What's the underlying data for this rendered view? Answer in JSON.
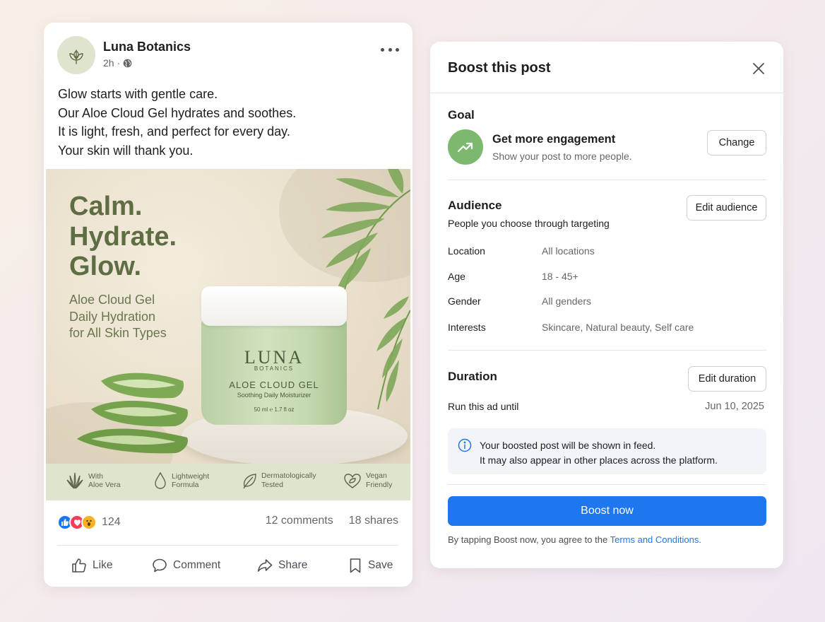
{
  "post": {
    "page_name": "Luna Botanics",
    "time": "2h",
    "separator": "·",
    "caption_lines": [
      "Glow starts with gentle care.",
      "Our Aloe Cloud Gel hydrates and soothes.",
      "It is light, fresh, and perfect for every day.",
      "Your skin will thank you."
    ],
    "image": {
      "headline": [
        "Calm.",
        "Hydrate.",
        "Glow."
      ],
      "subline": [
        "Aloe Cloud Gel",
        "Daily Hydration",
        "for All Skin Types"
      ],
      "jar": {
        "brand": "LUNA",
        "brand_sub": "BOTANICS",
        "product": "ALOE CLOUD GEL",
        "description": "Soothing Daily Moisturizer",
        "volume": "50 ml ℮ 1.7 fl oz"
      },
      "features": [
        {
          "icon": "aloe-icon",
          "lines": [
            "With",
            "Aloe Vera"
          ]
        },
        {
          "icon": "droplet-icon",
          "lines": [
            "Lightweight",
            "Formula"
          ]
        },
        {
          "icon": "leaf-icon",
          "lines": [
            "Dermatologically",
            "Tested"
          ]
        },
        {
          "icon": "heart-leaf-icon",
          "lines": [
            "Vegan",
            "Friendly"
          ]
        }
      ]
    },
    "reactions_count": "124",
    "comments": "12 comments",
    "shares": "18 shares",
    "actions": {
      "like": "Like",
      "comment": "Comment",
      "share": "Share",
      "save": "Save"
    }
  },
  "boost": {
    "title": "Boost this post",
    "goal": {
      "section": "Goal",
      "name": "Get more engagement",
      "description": "Show your post to more people.",
      "change_label": "Change"
    },
    "audience": {
      "section": "Audience",
      "subtitle": "People you choose through targeting",
      "edit_label": "Edit audience",
      "rows": [
        {
          "key": "Location",
          "value": "All locations"
        },
        {
          "key": "Age",
          "value": "18 - 45+"
        },
        {
          "key": "Gender",
          "value": "All genders"
        },
        {
          "key": "Interests",
          "value": "Skincare, Natural beauty, Self care"
        }
      ]
    },
    "duration": {
      "section": "Duration",
      "edit_label": "Edit duration",
      "run_label": "Run this ad until",
      "end_date": "Jun 10, 2025"
    },
    "info": {
      "line1": "Your boosted post will be shown in feed.",
      "line2": "It may also appear in other places across the platform."
    },
    "boost_label": "Boost now",
    "terms_prefix": "By tapping Boost now, you agree to the ",
    "terms_link": "Terms and Conditions."
  },
  "colors": {
    "accent": "#1f77f0",
    "goal_green": "#7cb96f",
    "headline_green": "#5f6d45"
  }
}
